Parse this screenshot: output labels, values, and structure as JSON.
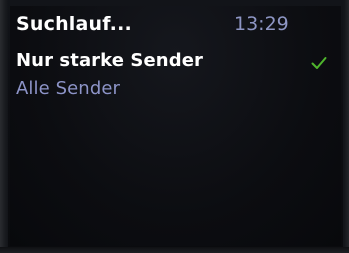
{
  "header": {
    "title": "Suchlauf...",
    "time": "13:29"
  },
  "menu": {
    "items": [
      {
        "label": "Nur starke Sender",
        "selected": true
      },
      {
        "label": "Alle Sender",
        "selected": false
      }
    ]
  },
  "icons": {
    "selected_marker": "checkmark-icon"
  },
  "colors": {
    "text_primary": "#ffffff",
    "text_secondary": "#8d94c8",
    "clock": "#8e96c4",
    "check": "#4fb52c",
    "background": "#0c0d11"
  }
}
